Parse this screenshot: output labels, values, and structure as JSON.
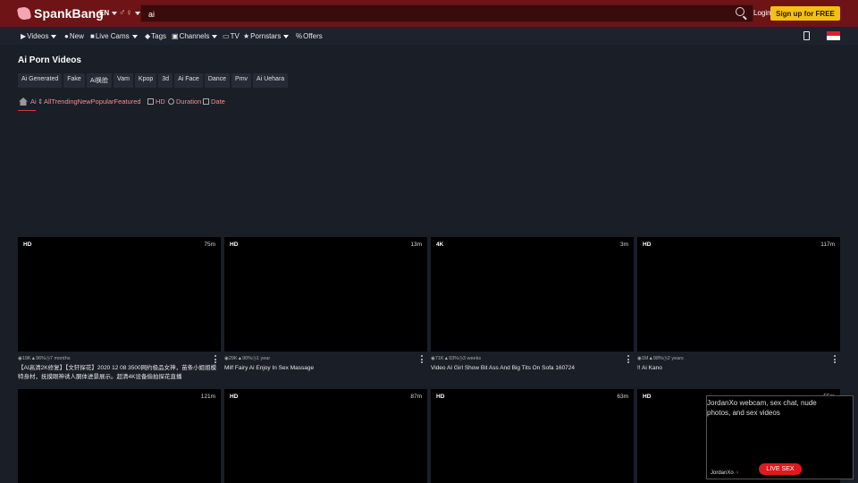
{
  "header": {
    "brand": "SpankBang",
    "lang": "EN",
    "gender_icon": "♂♀",
    "search_value": "ai",
    "login": "Login",
    "signup": "Sign up for FREE"
  },
  "nav": {
    "videos": "Videos",
    "new": "New",
    "live_cams": "Live Cams",
    "tags": "Tags",
    "channels": "Channels",
    "tv": "TV",
    "pornstars": "Pornstars",
    "offers": "Offers"
  },
  "page": {
    "title": "Ai Porn Videos",
    "tags": [
      "Ai Generated",
      "Fake",
      "Ai换脸",
      "Vam",
      "Kpop",
      "3d",
      "Ai Face",
      "Dance",
      "Pmv",
      "Ai Uehara"
    ],
    "filters": {
      "home": "Ai",
      "tabs": "AllTrendingNewPopularFeatured",
      "hd": "HD",
      "duration": "Duration",
      "date": "Date"
    }
  },
  "videos": [
    {
      "badge": "HD",
      "duration": "75m",
      "views": "19K",
      "rating": "96%",
      "age": "7 months",
      "title": "【AI高清2K修复】【文轩探花】2020 12 08 3500网约极品女神，苗条小姐姐模特身材，抚摸眼神诱人胴体进景展示。超清4K设备偷拍探花直播"
    },
    {
      "badge": "HD",
      "duration": "13m",
      "views": "29K",
      "rating": "90%",
      "age": "1 year",
      "title": "Milf Fairy Ai Enjoy In Sex Massage"
    },
    {
      "badge": "4K",
      "duration": "3m",
      "views": "71K",
      "rating": "93%",
      "age": "3 weeks",
      "title": "Video AI Girl Show Bit Ass And Big Tits On Sofa 160724"
    },
    {
      "badge": "HD",
      "duration": "117m",
      "views": "1M",
      "rating": "98%",
      "age": "2 years",
      "title": "!! Ai Kano"
    },
    {
      "badge": "",
      "duration": "121m"
    },
    {
      "badge": "HD",
      "duration": "87m"
    },
    {
      "badge": "HD",
      "duration": "63m"
    },
    {
      "badge": "HD",
      "duration": "55m"
    }
  ],
  "live": {
    "alt": "JordanXo webcam, sex chat, nude photos, and sex videos",
    "user": "JordanXo",
    "button": "LIVE SEX"
  },
  "colors": {
    "topbar": "#6e1416",
    "accent": "#f4c014",
    "live": "#e0191e"
  }
}
